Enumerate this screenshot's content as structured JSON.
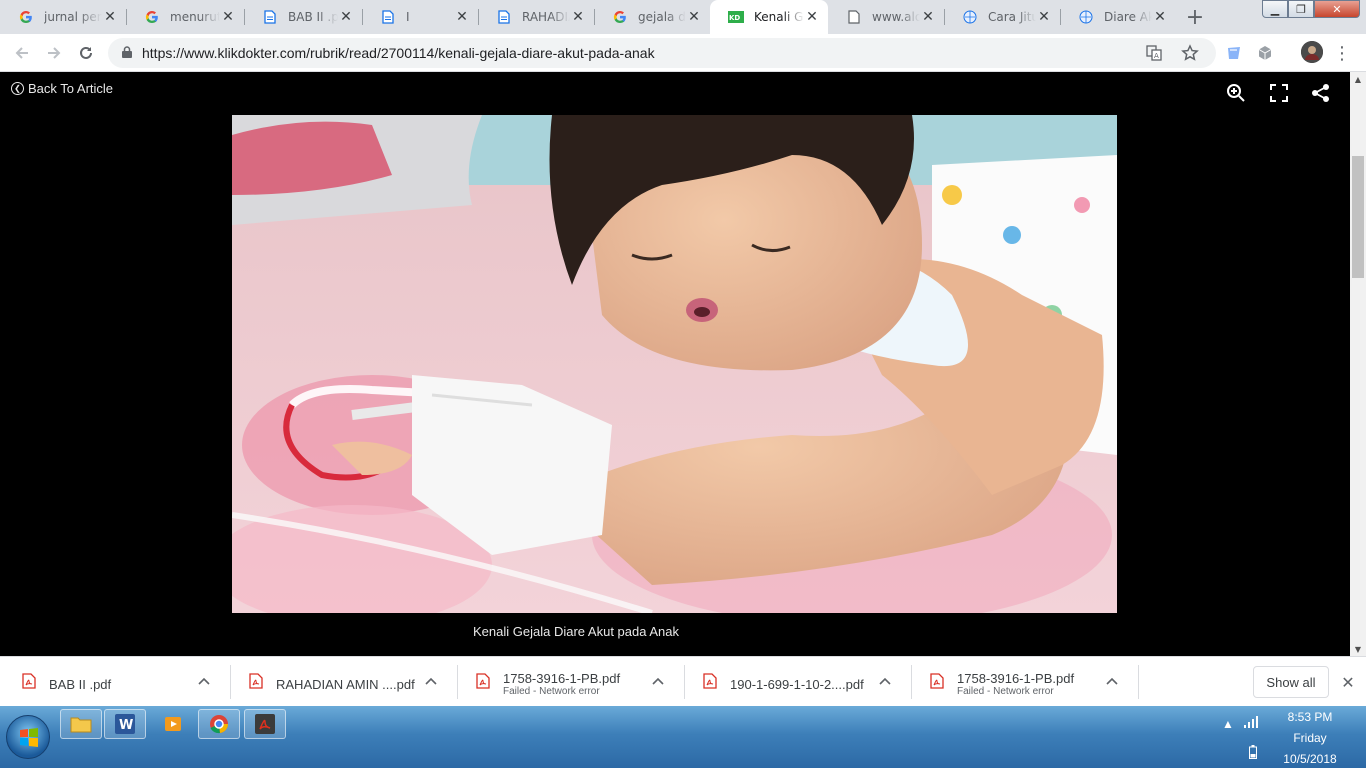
{
  "tabs": [
    {
      "title": "jurnal pen",
      "icon": "google-icon",
      "active": false
    },
    {
      "title": "menurut t",
      "icon": "google-icon",
      "active": false
    },
    {
      "title": "BAB II .pdf",
      "icon": "document-icon",
      "active": false
    },
    {
      "title": "I",
      "icon": "document-icon",
      "active": false
    },
    {
      "title": "RAHADIA",
      "icon": "document-icon",
      "active": false
    },
    {
      "title": "gejala diar",
      "icon": "google-icon",
      "active": false
    },
    {
      "title": "Kenali Ge",
      "icon": "klikdokter-icon",
      "active": true
    },
    {
      "title": "www.aloc",
      "icon": "page-icon",
      "active": false
    },
    {
      "title": "Cara Jitu",
      "icon": "site-icon",
      "active": false
    },
    {
      "title": "Diare Aku",
      "icon": "site-icon",
      "active": false
    }
  ],
  "address_bar": {
    "url": "https://www.klikdokter.com/rubrik/read/2700114/kenali-gejala-diare-akut-pada-anak"
  },
  "viewer": {
    "back_label": "Back To Article",
    "caption": "Kenali Gejala Diare Akut pada Anak"
  },
  "downloads": [
    {
      "name": "BAB II .pdf",
      "status": ""
    },
    {
      "name": "RAHADIAN AMIN ....pdf",
      "status": ""
    },
    {
      "name": "1758-3916-1-PB.pdf",
      "status": "Failed - Network error"
    },
    {
      "name": "190-1-699-1-10-2....pdf",
      "status": ""
    },
    {
      "name": "1758-3916-1-PB.pdf",
      "status": "Failed - Network error"
    }
  ],
  "show_all_label": "Show all",
  "clock": {
    "time": "8:53 PM",
    "day": "Friday",
    "date": "10/5/2018"
  },
  "colors": {
    "accent": "#1a73e8",
    "pdf_red": "#d93025",
    "taskbar": "#3d7fb9"
  }
}
